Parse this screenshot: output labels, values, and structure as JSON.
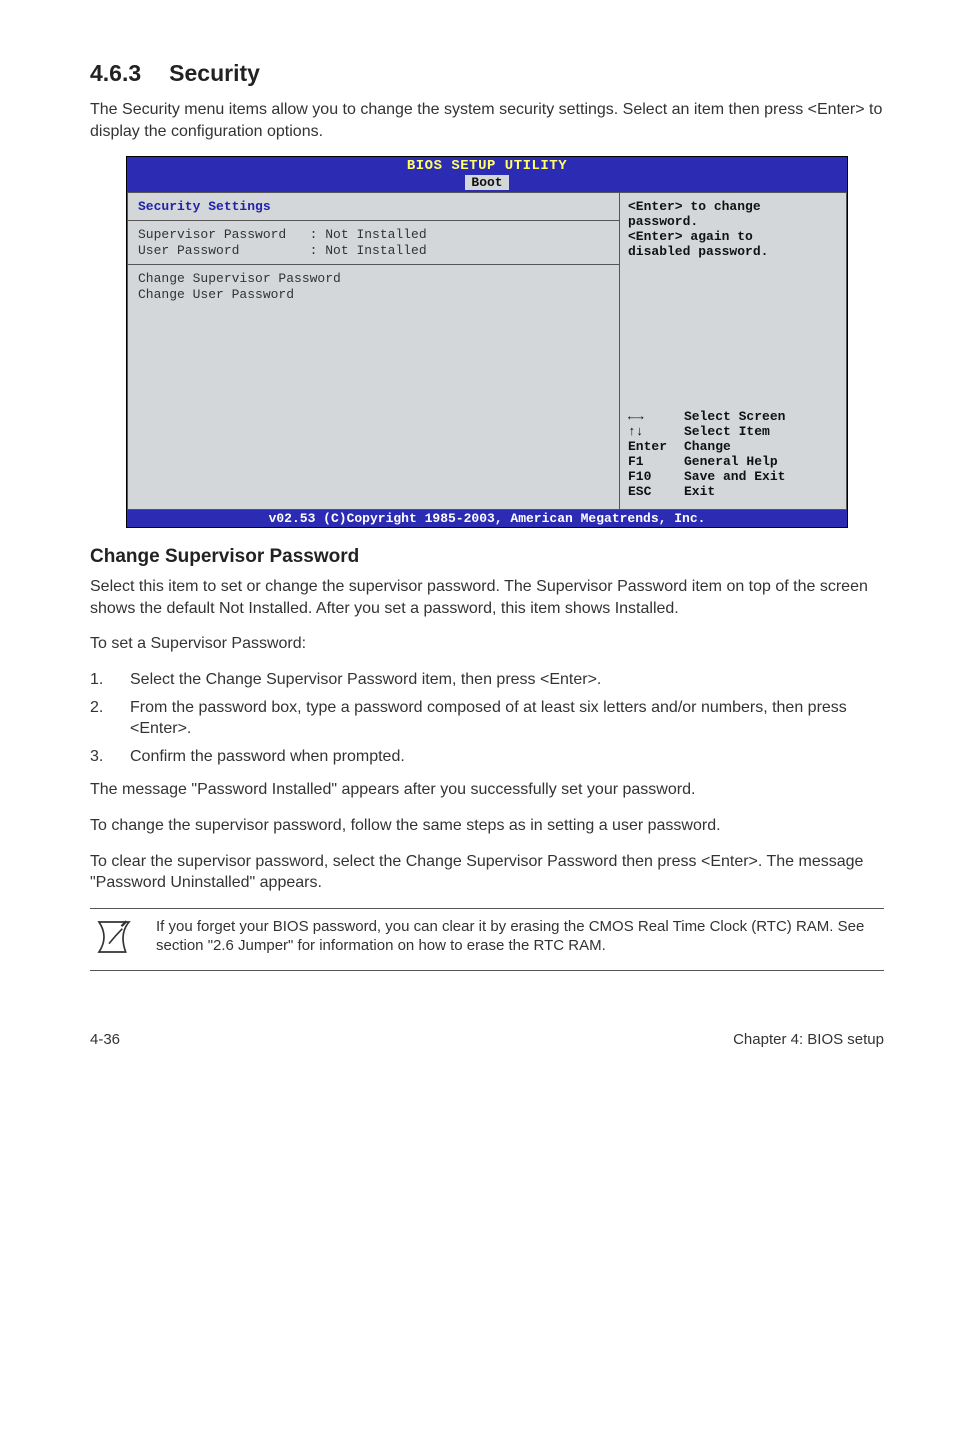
{
  "title": {
    "number": "4.6.3",
    "text": "Security"
  },
  "intro": "The Security menu items allow you to change the system security settings. Select an item then press <Enter> to display the configuration options.",
  "bios": {
    "util_title": "BIOS SETUP UTILITY",
    "tab": "Boot",
    "heading": "Security Settings",
    "rows": {
      "sup_label": "Supervisor Password",
      "sup_value": ": Not Installed",
      "usr_label": "User Password",
      "usr_value": ": Not Installed",
      "change_sup": "Change Supervisor Password",
      "change_usr": "Change User Password"
    },
    "help": {
      "l1": "<Enter> to change",
      "l2": "password.",
      "l3": "<Enter> again to",
      "l4": "disabled password."
    },
    "nav": {
      "screen_k": "←→",
      "screen": "Select Screen",
      "item_k": "↑↓",
      "item": "Select Item",
      "enter_k": "Enter",
      "enter": "Change",
      "f1_k": "F1",
      "f1": "General Help",
      "f10_k": "F10",
      "f10": "Save and Exit",
      "esc_k": "ESC",
      "esc": "Exit"
    },
    "footer": "v02.53 (C)Copyright 1985-2003, American Megatrends, Inc."
  },
  "sub1": "Change Supervisor Password",
  "p1": "Select this item to set or change the supervisor password. The Supervisor Password item on top of the screen shows the default Not Installed. After you set a password, this item shows Installed.",
  "p2": "To set a Supervisor Password:",
  "steps": {
    "s1": "Select the Change Supervisor Password item, then press <Enter>.",
    "s2": "From the password box, type a password composed of at least six letters and/or numbers, then press <Enter>.",
    "s3": "Confirm the password when prompted."
  },
  "p3": "The message \"Password Installed\" appears after you successfully set your password.",
  "p4": "To change the supervisor password, follow the same steps as in setting a user password.",
  "p5": "To clear the supervisor password, select the Change Supervisor Password then press <Enter>. The message \"Password Uninstalled\" appears.",
  "note": "If you forget your BIOS password, you can clear it by erasing the CMOS Real Time Clock (RTC) RAM. See section \"2.6  Jumper\" for information on how to erase the RTC RAM.",
  "footer": {
    "left": "4-36",
    "right": "Chapter 4: BIOS setup"
  }
}
